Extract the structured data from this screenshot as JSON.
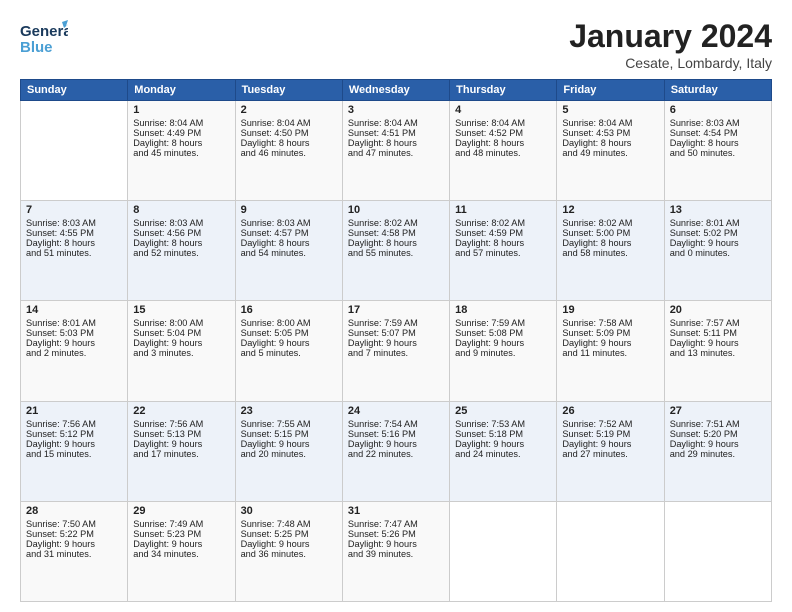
{
  "header": {
    "logo_general": "General",
    "logo_blue": "Blue",
    "title": "January 2024",
    "location": "Cesate, Lombardy, Italy"
  },
  "weekdays": [
    "Sunday",
    "Monday",
    "Tuesday",
    "Wednesday",
    "Thursday",
    "Friday",
    "Saturday"
  ],
  "weeks": [
    [
      {
        "day": "",
        "lines": []
      },
      {
        "day": "1",
        "lines": [
          "Sunrise: 8:04 AM",
          "Sunset: 4:49 PM",
          "Daylight: 8 hours",
          "and 45 minutes."
        ]
      },
      {
        "day": "2",
        "lines": [
          "Sunrise: 8:04 AM",
          "Sunset: 4:50 PM",
          "Daylight: 8 hours",
          "and 46 minutes."
        ]
      },
      {
        "day": "3",
        "lines": [
          "Sunrise: 8:04 AM",
          "Sunset: 4:51 PM",
          "Daylight: 8 hours",
          "and 47 minutes."
        ]
      },
      {
        "day": "4",
        "lines": [
          "Sunrise: 8:04 AM",
          "Sunset: 4:52 PM",
          "Daylight: 8 hours",
          "and 48 minutes."
        ]
      },
      {
        "day": "5",
        "lines": [
          "Sunrise: 8:04 AM",
          "Sunset: 4:53 PM",
          "Daylight: 8 hours",
          "and 49 minutes."
        ]
      },
      {
        "day": "6",
        "lines": [
          "Sunrise: 8:03 AM",
          "Sunset: 4:54 PM",
          "Daylight: 8 hours",
          "and 50 minutes."
        ]
      }
    ],
    [
      {
        "day": "7",
        "lines": [
          "Sunrise: 8:03 AM",
          "Sunset: 4:55 PM",
          "Daylight: 8 hours",
          "and 51 minutes."
        ]
      },
      {
        "day": "8",
        "lines": [
          "Sunrise: 8:03 AM",
          "Sunset: 4:56 PM",
          "Daylight: 8 hours",
          "and 52 minutes."
        ]
      },
      {
        "day": "9",
        "lines": [
          "Sunrise: 8:03 AM",
          "Sunset: 4:57 PM",
          "Daylight: 8 hours",
          "and 54 minutes."
        ]
      },
      {
        "day": "10",
        "lines": [
          "Sunrise: 8:02 AM",
          "Sunset: 4:58 PM",
          "Daylight: 8 hours",
          "and 55 minutes."
        ]
      },
      {
        "day": "11",
        "lines": [
          "Sunrise: 8:02 AM",
          "Sunset: 4:59 PM",
          "Daylight: 8 hours",
          "and 57 minutes."
        ]
      },
      {
        "day": "12",
        "lines": [
          "Sunrise: 8:02 AM",
          "Sunset: 5:00 PM",
          "Daylight: 8 hours",
          "and 58 minutes."
        ]
      },
      {
        "day": "13",
        "lines": [
          "Sunrise: 8:01 AM",
          "Sunset: 5:02 PM",
          "Daylight: 9 hours",
          "and 0 minutes."
        ]
      }
    ],
    [
      {
        "day": "14",
        "lines": [
          "Sunrise: 8:01 AM",
          "Sunset: 5:03 PM",
          "Daylight: 9 hours",
          "and 2 minutes."
        ]
      },
      {
        "day": "15",
        "lines": [
          "Sunrise: 8:00 AM",
          "Sunset: 5:04 PM",
          "Daylight: 9 hours",
          "and 3 minutes."
        ]
      },
      {
        "day": "16",
        "lines": [
          "Sunrise: 8:00 AM",
          "Sunset: 5:05 PM",
          "Daylight: 9 hours",
          "and 5 minutes."
        ]
      },
      {
        "day": "17",
        "lines": [
          "Sunrise: 7:59 AM",
          "Sunset: 5:07 PM",
          "Daylight: 9 hours",
          "and 7 minutes."
        ]
      },
      {
        "day": "18",
        "lines": [
          "Sunrise: 7:59 AM",
          "Sunset: 5:08 PM",
          "Daylight: 9 hours",
          "and 9 minutes."
        ]
      },
      {
        "day": "19",
        "lines": [
          "Sunrise: 7:58 AM",
          "Sunset: 5:09 PM",
          "Daylight: 9 hours",
          "and 11 minutes."
        ]
      },
      {
        "day": "20",
        "lines": [
          "Sunrise: 7:57 AM",
          "Sunset: 5:11 PM",
          "Daylight: 9 hours",
          "and 13 minutes."
        ]
      }
    ],
    [
      {
        "day": "21",
        "lines": [
          "Sunrise: 7:56 AM",
          "Sunset: 5:12 PM",
          "Daylight: 9 hours",
          "and 15 minutes."
        ]
      },
      {
        "day": "22",
        "lines": [
          "Sunrise: 7:56 AM",
          "Sunset: 5:13 PM",
          "Daylight: 9 hours",
          "and 17 minutes."
        ]
      },
      {
        "day": "23",
        "lines": [
          "Sunrise: 7:55 AM",
          "Sunset: 5:15 PM",
          "Daylight: 9 hours",
          "and 20 minutes."
        ]
      },
      {
        "day": "24",
        "lines": [
          "Sunrise: 7:54 AM",
          "Sunset: 5:16 PM",
          "Daylight: 9 hours",
          "and 22 minutes."
        ]
      },
      {
        "day": "25",
        "lines": [
          "Sunrise: 7:53 AM",
          "Sunset: 5:18 PM",
          "Daylight: 9 hours",
          "and 24 minutes."
        ]
      },
      {
        "day": "26",
        "lines": [
          "Sunrise: 7:52 AM",
          "Sunset: 5:19 PM",
          "Daylight: 9 hours",
          "and 27 minutes."
        ]
      },
      {
        "day": "27",
        "lines": [
          "Sunrise: 7:51 AM",
          "Sunset: 5:20 PM",
          "Daylight: 9 hours",
          "and 29 minutes."
        ]
      }
    ],
    [
      {
        "day": "28",
        "lines": [
          "Sunrise: 7:50 AM",
          "Sunset: 5:22 PM",
          "Daylight: 9 hours",
          "and 31 minutes."
        ]
      },
      {
        "day": "29",
        "lines": [
          "Sunrise: 7:49 AM",
          "Sunset: 5:23 PM",
          "Daylight: 9 hours",
          "and 34 minutes."
        ]
      },
      {
        "day": "30",
        "lines": [
          "Sunrise: 7:48 AM",
          "Sunset: 5:25 PM",
          "Daylight: 9 hours",
          "and 36 minutes."
        ]
      },
      {
        "day": "31",
        "lines": [
          "Sunrise: 7:47 AM",
          "Sunset: 5:26 PM",
          "Daylight: 9 hours",
          "and 39 minutes."
        ]
      },
      {
        "day": "",
        "lines": []
      },
      {
        "day": "",
        "lines": []
      },
      {
        "day": "",
        "lines": []
      }
    ]
  ]
}
